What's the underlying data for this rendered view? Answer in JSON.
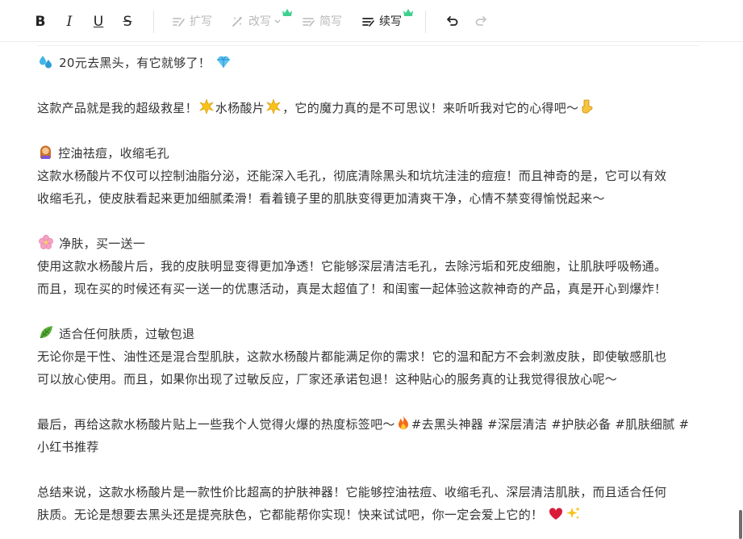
{
  "toolbar": {
    "bold_label": "B",
    "italic_label": "I",
    "underline_label": "U",
    "strike_label": "S",
    "expand_label": "扩写",
    "rewrite_label": "改写",
    "simplify_label": "简写",
    "continue_label": "续写",
    "crown_color": "#3fd08f"
  },
  "content": {
    "l1": "20元去黑头，有它就够了！",
    "l2a": "这款产品就是我的超级救星！",
    "l2b": "水杨酸片",
    "l2c": "，它的魔力真的是不可思议！来听听我对它的心得吧～",
    "h1": "控油祛痘，收缩毛孔",
    "p1a": "这款水杨酸片不仅可以控制油脂分泌，还能深入毛孔，彻底清除黑头和坑坑洼洼的痘痘！而且神奇的是，它可以有效",
    "p1b": "收缩毛孔，使皮肤看起来更加细腻柔滑！看着镜子里的肌肤变得更加清爽干净，心情不禁变得愉悦起来～",
    "h2": "净肤，买一送一",
    "p2a": "使用这款水杨酸片后，我的皮肤明显变得更加净透！它能够深层清洁毛孔，去除污垢和死皮细胞，让肌肤呼吸畅通。",
    "p2b": "而且，现在买的时候还有买一送一的优惠活动，真是太超值了！和闺蜜一起体验这款神奇的产品，真是开心到爆炸！",
    "h3": "适合任何肤质，过敏包退",
    "p3a": "无论你是干性、油性还是混合型肌肤，这款水杨酸片都能满足你的需求！它的温和配方不会刺激皮肤，即使敏感肌也",
    "p3b": "可以放心使用。而且，如果你出现了过敏反应，厂家还承诺包退！这种贴心的服务真的让我觉得很放心呢～",
    "p4a": "最后，再给这款水杨酸片贴上一些我个人觉得火爆的热度标签吧～",
    "p4b": "#去黑头神器 #深层清洁 #护肤必备 #肌肤细腻 #",
    "p4c": "小红书推荐",
    "p5a": "总结来说，这款水杨酸片是一款性价比超高的护肤神器！它能够控油祛痘、收缩毛孔、深层清洁肌肤，而且适合任何",
    "p5b": "肤质。无论是想要去黑头还是提亮肤色，它都能帮你实现！快来试试吧，你一定会爱上它的！"
  }
}
